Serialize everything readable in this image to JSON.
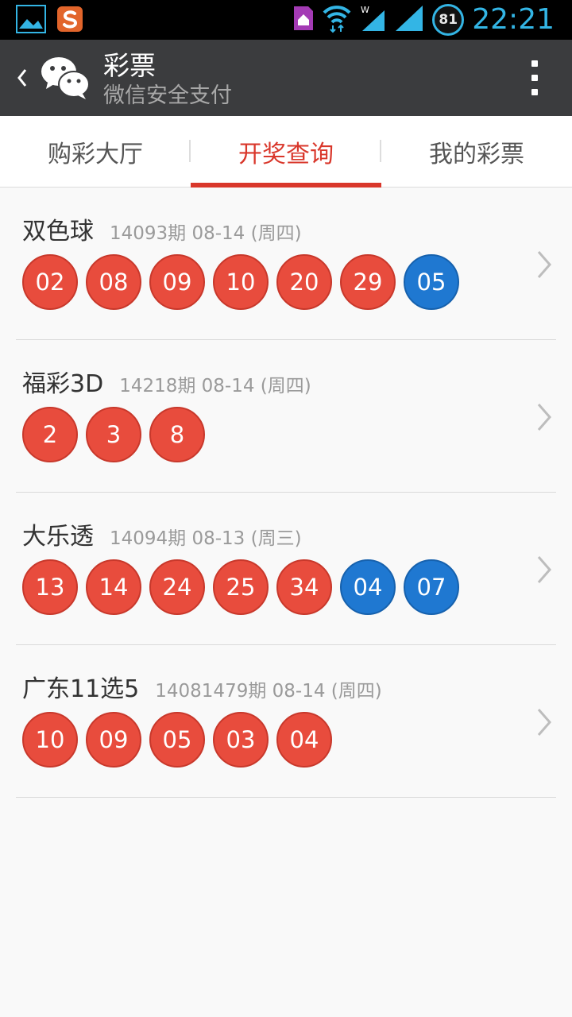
{
  "status_bar": {
    "time": "22:21",
    "battery": "81",
    "icons": [
      "gallery-icon",
      "sogou-icon",
      "sim-home-icon",
      "wifi-icon",
      "signal-icon-1",
      "signal-icon-2"
    ]
  },
  "header": {
    "title": "彩票",
    "subtitle": "微信安全支付",
    "icons": [
      "back-icon",
      "wechat-logo-icon",
      "overflow-menu-icon"
    ]
  },
  "tabs": [
    {
      "label": "购彩大厅",
      "active": false
    },
    {
      "label": "开奖查询",
      "active": true
    },
    {
      "label": "我的彩票",
      "active": false
    }
  ],
  "lotteries": [
    {
      "name": "双色球",
      "meta": "14093期 08-14 (周四)",
      "balls": [
        {
          "n": "02",
          "color": "red"
        },
        {
          "n": "08",
          "color": "red"
        },
        {
          "n": "09",
          "color": "red"
        },
        {
          "n": "10",
          "color": "red"
        },
        {
          "n": "20",
          "color": "red"
        },
        {
          "n": "29",
          "color": "red"
        },
        {
          "n": "05",
          "color": "blue"
        }
      ]
    },
    {
      "name": "福彩3D",
      "meta": "14218期 08-14 (周四)",
      "balls": [
        {
          "n": "2",
          "color": "red"
        },
        {
          "n": "3",
          "color": "red"
        },
        {
          "n": "8",
          "color": "red"
        }
      ]
    },
    {
      "name": "大乐透",
      "meta": "14094期 08-13 (周三)",
      "balls": [
        {
          "n": "13",
          "color": "red"
        },
        {
          "n": "14",
          "color": "red"
        },
        {
          "n": "24",
          "color": "red"
        },
        {
          "n": "25",
          "color": "red"
        },
        {
          "n": "34",
          "color": "red"
        },
        {
          "n": "04",
          "color": "blue"
        },
        {
          "n": "07",
          "color": "blue"
        }
      ]
    },
    {
      "name": "广东11选5",
      "meta": "14081479期 08-14 (周四)",
      "balls": [
        {
          "n": "10",
          "color": "red"
        },
        {
          "n": "09",
          "color": "red"
        },
        {
          "n": "05",
          "color": "red"
        },
        {
          "n": "03",
          "color": "red"
        },
        {
          "n": "04",
          "color": "red"
        }
      ]
    }
  ],
  "colors": {
    "accent": "#d9372b",
    "ball_red": "#e84c3d",
    "ball_blue": "#1f78d1",
    "action_bar": "#3b3c3e"
  }
}
